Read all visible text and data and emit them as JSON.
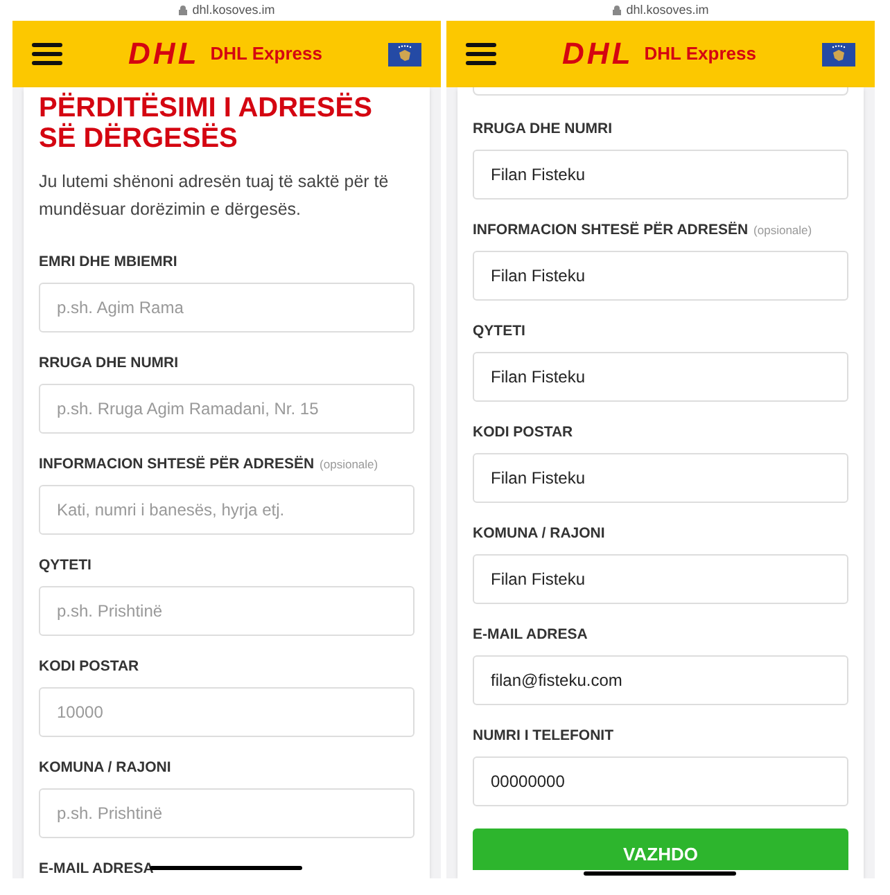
{
  "screens": [
    {
      "url": "dhl.kosoves.im",
      "header": {
        "logo_text": "DHL",
        "brand": "DHL Express"
      },
      "title": "PËRDITËSIMI I ADRESËS SË DËRGESËS",
      "intro": "Ju lutemi shënoni adresën tuaj të saktë për të mundësuar dorëzimin e dërgesës.",
      "partial_field_above": false,
      "fields": [
        {
          "label": "EMRI DHE MBIEMRI",
          "placeholder": "p.sh. Agim Rama"
        },
        {
          "label": "RRUGA DHE NUMRI",
          "placeholder": "p.sh. Rruga Agim Ramadani, Nr. 15"
        },
        {
          "label": "INFORMACION SHTESË PËR ADRESËN",
          "note": "(opsionale)",
          "placeholder": "Kati, numri i banesës, hyrja etj."
        },
        {
          "label": "QYTETI",
          "placeholder": "p.sh. Prishtinë"
        },
        {
          "label": "KODI POSTAR",
          "placeholder": "10000"
        },
        {
          "label": "KOMUNA / RAJONI",
          "placeholder": "p.sh. Prishtinë"
        },
        {
          "label": "E-MAIL ADRESA"
        }
      ]
    },
    {
      "url": "dhl.kosoves.im",
      "header": {
        "logo_text": "DHL",
        "brand": "DHL Express"
      },
      "partial_field_above": true,
      "fields": [
        {
          "label": "RRUGA DHE NUMRI",
          "value": "Filan Fisteku"
        },
        {
          "label": "INFORMACION SHTESË PËR ADRESËN",
          "note": "(opsionale)",
          "value": "Filan Fisteku"
        },
        {
          "label": "QYTETI",
          "value": "Filan Fisteku"
        },
        {
          "label": "KODI POSTAR",
          "value": "Filan Fisteku"
        },
        {
          "label": "KOMUNA / RAJONI",
          "value": "Filan Fisteku"
        },
        {
          "label": "E-MAIL ADRESA",
          "value": "filan@fisteku.com"
        },
        {
          "label": "NUMRI I TELEFONIT",
          "value": "00000000"
        }
      ],
      "button": "VAZHDO"
    }
  ]
}
